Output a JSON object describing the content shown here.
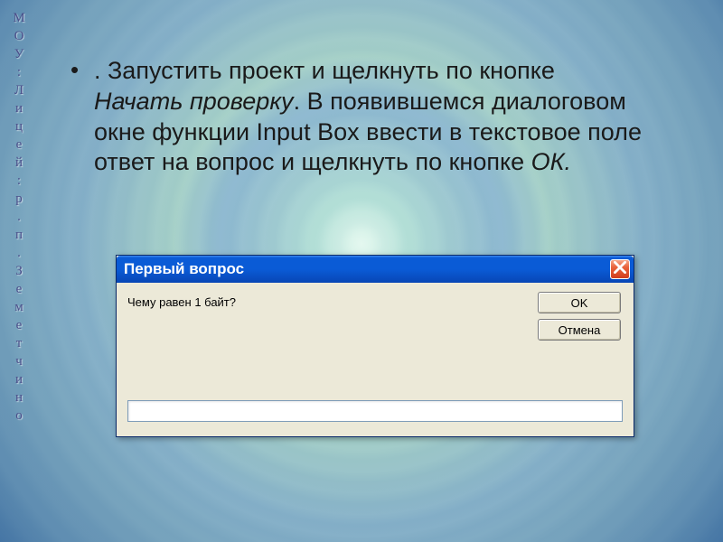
{
  "sidebar_text": "МОУ:Лицей: р.п .Земетчино",
  "bullet": {
    "marker": "•",
    "segments": {
      "pre": ". Запустить проект и щелкнуть по кнопке ",
      "em1": "Начать проверку",
      "mid": ". В появившемся диалоговом окне функции Input Box ввести в текстовое поле ответ на вопрос и щелкнуть по кнопке ",
      "em2": "ОК.",
      "post": ""
    }
  },
  "dialog": {
    "title": "Первый вопрос",
    "prompt": "Чему равен 1 байт?",
    "ok_label": "OK",
    "cancel_label": "Отмена",
    "input_value": ""
  }
}
